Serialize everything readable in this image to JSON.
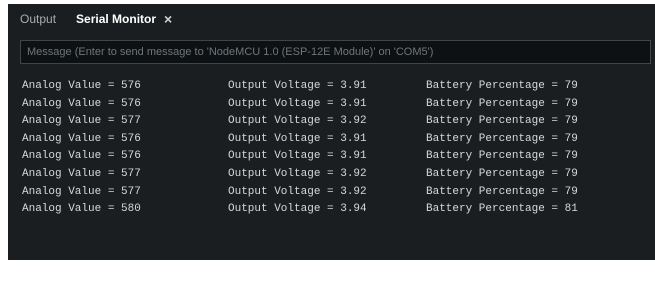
{
  "tabs": [
    {
      "label": "Output"
    },
    {
      "label": "Serial Monitor",
      "close": "×"
    }
  ],
  "message": {
    "placeholder": "Message (Enter to send message to 'NodeMCU 1.0 (ESP-12E Module)' on 'COM5')"
  },
  "output_lines": [
    {
      "analog": "Analog Value = 576",
      "voltage": "Output Voltage = 3.91",
      "battery": "Battery Percentage = 79"
    },
    {
      "analog": "Analog Value = 576",
      "voltage": "Output Voltage = 3.91",
      "battery": "Battery Percentage = 79"
    },
    {
      "analog": "Analog Value = 577",
      "voltage": "Output Voltage = 3.92",
      "battery": "Battery Percentage = 79"
    },
    {
      "analog": "Analog Value = 576",
      "voltage": "Output Voltage = 3.91",
      "battery": "Battery Percentage = 79"
    },
    {
      "analog": "Analog Value = 576",
      "voltage": "Output Voltage = 3.91",
      "battery": "Battery Percentage = 79"
    },
    {
      "analog": "Analog Value = 577",
      "voltage": "Output Voltage = 3.92",
      "battery": "Battery Percentage = 79"
    },
    {
      "analog": "Analog Value = 577",
      "voltage": "Output Voltage = 3.92",
      "battery": "Battery Percentage = 79"
    },
    {
      "analog": "Analog Value = 580",
      "voltage": "Output Voltage = 3.94",
      "battery": "Battery Percentage = 81"
    }
  ],
  "colors": {
    "background": "#1b1e20",
    "text": "#d6d9db",
    "input_border": "#3f4548"
  }
}
